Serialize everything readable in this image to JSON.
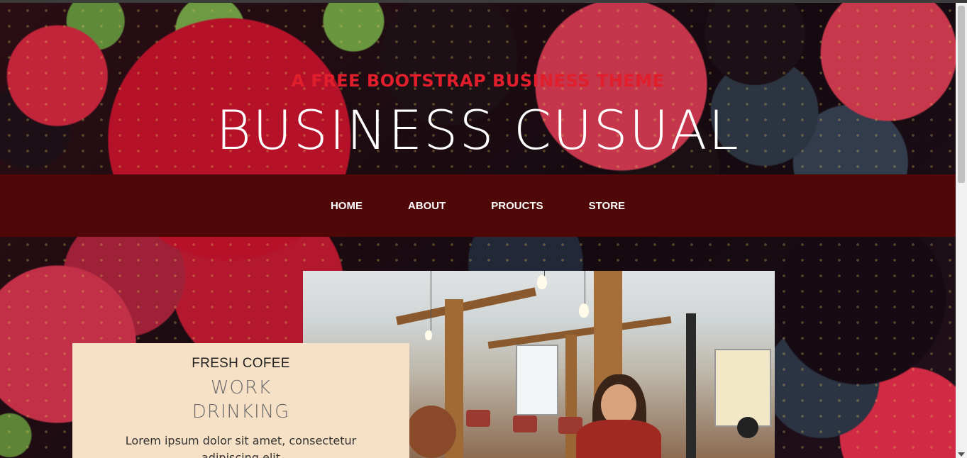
{
  "header": {
    "subheading": "A FREE BOOTSTRAP BUSINESS THEME",
    "heading": "BUSINESS CUSUAL"
  },
  "nav": {
    "items": [
      {
        "label": "HOME"
      },
      {
        "label": "ABOUT"
      },
      {
        "label": "PROUCTS"
      },
      {
        "label": "STORE"
      }
    ]
  },
  "intro": {
    "upper": "FRESH COFEE",
    "lower_line1": "WORK",
    "lower_line2": "DRINKING",
    "text": "Lorem ipsum dolor sit amet, consectetur adipiscing elit"
  },
  "colors": {
    "nav_bg": "#500707",
    "subheading": "#e01e2c",
    "intro_bg": "#f7e1c6"
  }
}
